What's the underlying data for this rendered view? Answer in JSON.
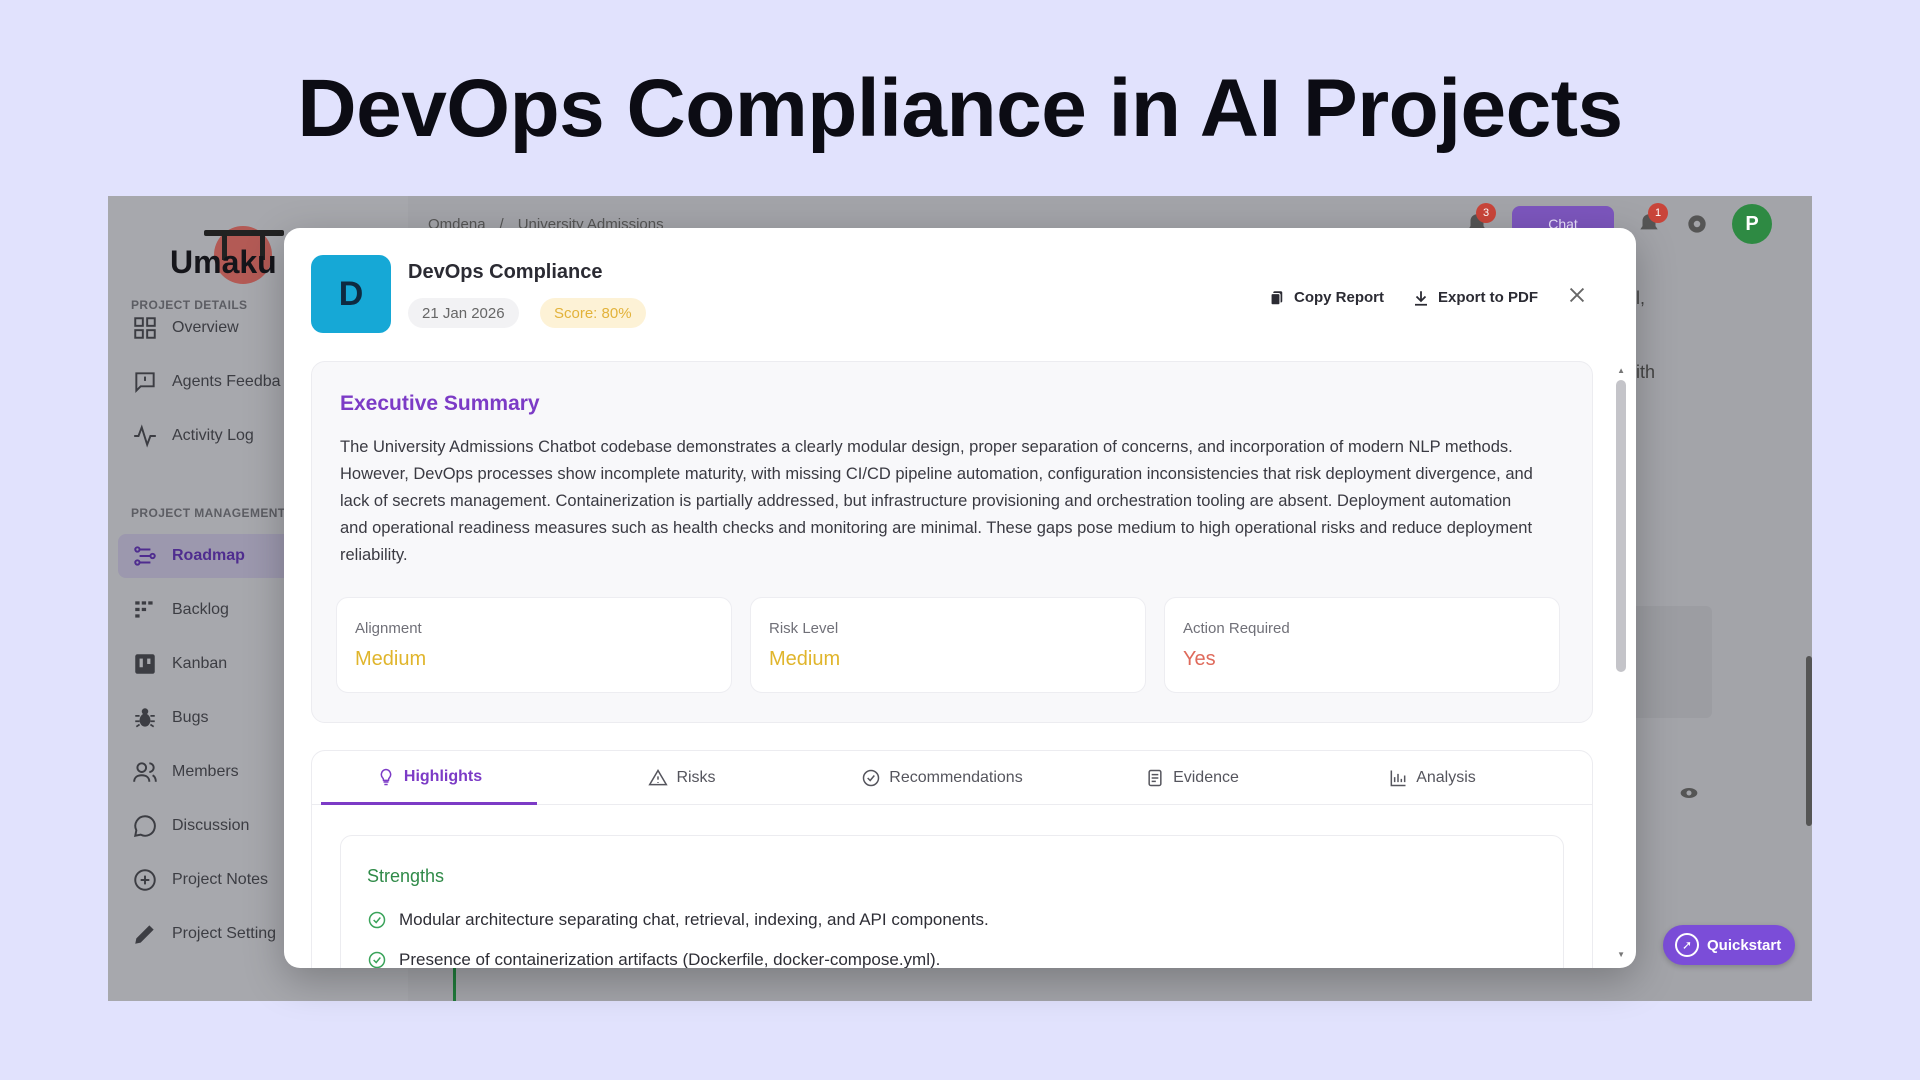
{
  "slide": {
    "title": "DevOps Compliance in AI Projects"
  },
  "app": {
    "logo_text": "Umaku",
    "breadcrumb": [
      "Omdena",
      "/",
      "University Admissions"
    ],
    "topbar": {
      "chat_label": "Chat",
      "notif_count_1": "3",
      "notif_count_2": "1",
      "avatar_initial": "P"
    },
    "sidebar": {
      "section_details": "PROJECT DETAILS",
      "section_management": "PROJECT MANAGEMENT",
      "items": [
        {
          "label": "Overview",
          "icon": "grid-icon"
        },
        {
          "label": "Agents Feedba",
          "icon": "message-square-icon"
        },
        {
          "label": "Activity Log",
          "icon": "activity-icon"
        },
        {
          "label": "Roadmap",
          "icon": "roadmap-icon"
        },
        {
          "label": "Backlog",
          "icon": "backlog-icon"
        },
        {
          "label": "Kanban",
          "icon": "kanban-icon"
        },
        {
          "label": "Bugs",
          "icon": "bug-icon"
        },
        {
          "label": "Members",
          "icon": "users-icon"
        },
        {
          "label": "Discussion",
          "icon": "chat-bubble-icon"
        },
        {
          "label": "Project Notes",
          "icon": "notes-icon"
        },
        {
          "label": "Project Setting",
          "icon": "pencil-icon"
        }
      ]
    },
    "background_text": {
      "a": "l,",
      "b": "ith"
    },
    "quickstart_label": "Quickstart"
  },
  "modal": {
    "avatar_initial": "D",
    "title": "DevOps Compliance",
    "date": "21 Jan 2026",
    "score": "Score: 80%",
    "actions": {
      "copy": "Copy Report",
      "export": "Export to PDF"
    },
    "summary": {
      "title": "Executive Summary",
      "text": "The University Admissions Chatbot codebase demonstrates a clearly modular design, proper separation of concerns, and incorporation of modern NLP methods. However, DevOps processes show incomplete maturity, with missing CI/CD pipeline automation, configuration inconsistencies that risk deployment divergence, and lack of secrets management. Containerization is partially addressed, but infrastructure provisioning and orchestration tooling are absent. Deployment automation and operational readiness measures such as health checks and monitoring are minimal. These gaps pose medium to high operational risks and reduce deployment reliability.",
      "metrics": [
        {
          "label": "Alignment",
          "value": "Medium",
          "color": "#e0b52c"
        },
        {
          "label": "Risk Level",
          "value": "Medium",
          "color": "#e0b52c"
        },
        {
          "label": "Action Required",
          "value": "Yes",
          "color": "#df6a5b"
        }
      ]
    },
    "tabs": [
      {
        "label": "Highlights",
        "icon": "lightbulb-icon",
        "active": true
      },
      {
        "label": "Risks",
        "icon": "warning-icon"
      },
      {
        "label": "Recommendations",
        "icon": "check-circle-icon"
      },
      {
        "label": "Evidence",
        "icon": "document-icon"
      },
      {
        "label": "Analysis",
        "icon": "bar-chart-icon"
      }
    ],
    "strengths": {
      "title": "Strengths",
      "items": [
        "Modular architecture separating chat, retrieval, indexing, and API components.",
        "Presence of containerization artifacts (Dockerfile, docker-compose.yml)."
      ]
    }
  }
}
